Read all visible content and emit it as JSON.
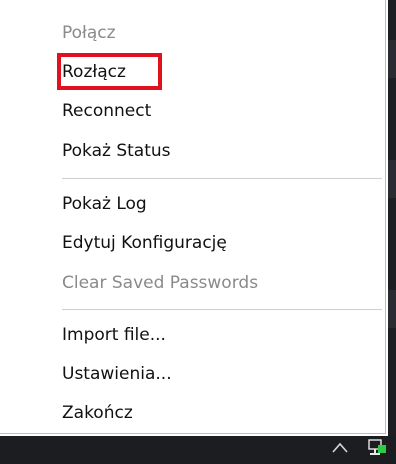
{
  "menu": {
    "items": [
      {
        "label": "Połącz",
        "enabled": false
      },
      {
        "label": "Rozłącz",
        "enabled": true,
        "highlighted": true
      },
      {
        "label": "Reconnect",
        "enabled": true
      },
      {
        "label": "Pokaż Status",
        "enabled": true
      },
      {
        "label": "Pokaż Log",
        "enabled": true
      },
      {
        "label": "Edytuj Konfigurację",
        "enabled": true
      },
      {
        "label": "Clear Saved Passwords",
        "enabled": false
      },
      {
        "label": "Import file...",
        "enabled": true
      },
      {
        "label": "Ustawienia...",
        "enabled": true
      },
      {
        "label": "Zakończ",
        "enabled": true
      }
    ]
  },
  "taskbar": {
    "icons": [
      "chevron-up-icon",
      "network-icon"
    ]
  },
  "colors": {
    "highlight": "#e0121f",
    "disabled_text": "#8a8a8a",
    "text": "#111111",
    "taskbar": "#1c1d20",
    "network_icon": "#2ecc40"
  }
}
